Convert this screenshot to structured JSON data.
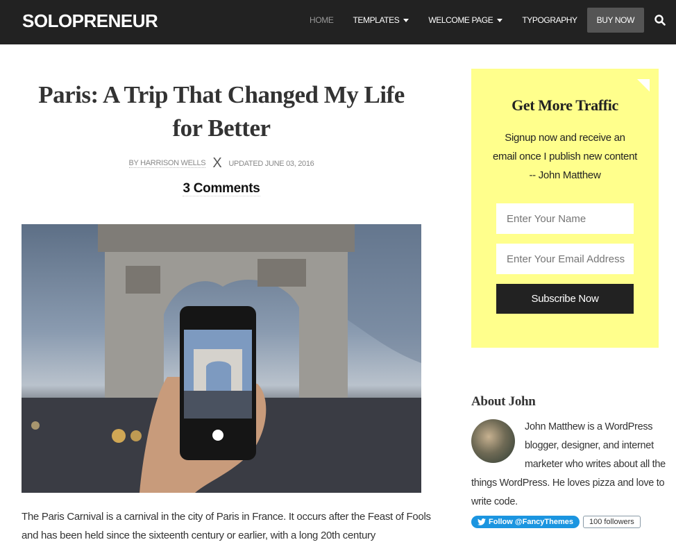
{
  "nav": {
    "logo": "SOLOPRENEUR",
    "items": [
      {
        "label": "HOME"
      },
      {
        "label": "TEMPLATES"
      },
      {
        "label": "WELCOME PAGE"
      },
      {
        "label": "TYPOGRAPHY"
      },
      {
        "label": "BUY NOW"
      }
    ],
    "search_icon": "search-icon"
  },
  "post": {
    "title": "Paris: A Trip That Changed My Life for Better",
    "author": "BY HARRISON WELLS",
    "separator": "X",
    "updated": "UPDATED JUNE 03, 2016",
    "comments": "3 Comments",
    "image": "Hand holding smartphone photographing the Arc de Triomphe",
    "body": "The Paris Carnival is a carnival in the city of Paris in France. It occurs after the Feast of Fools and has been held since the sixteenth century or earlier, with a long 20th century"
  },
  "optin": {
    "title": "Get More Traffic",
    "text": "Signup now and receive an email once I publish new content -- John Matthew",
    "name_placeholder": "Enter Your Name",
    "email_placeholder": "Enter Your Email Address",
    "button": "Subscribe Now",
    "bg_color": "#ffff8c"
  },
  "about": {
    "title": "About John",
    "text": "John Matthew is a WordPress blogger, designer, and internet marketer who writes about all the things WordPress. He loves pizza and love to write code.",
    "follow": "Follow @FancyThemes",
    "followers": "100 followers",
    "twitter_color": "#1b95e0"
  }
}
